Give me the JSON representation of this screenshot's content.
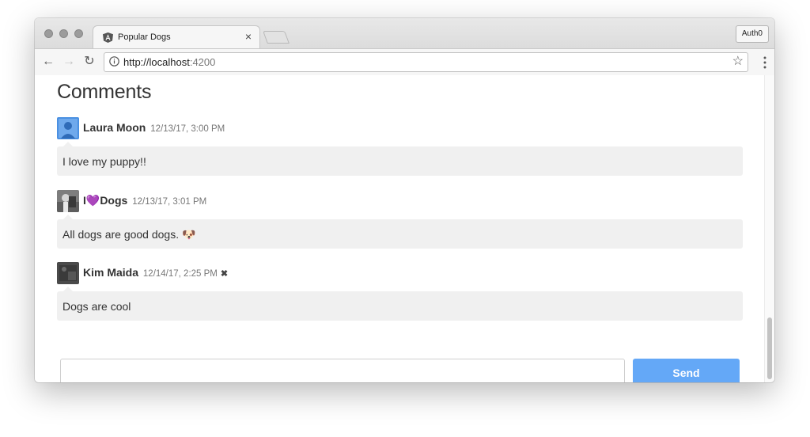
{
  "browser": {
    "tab_title": "Popular Dogs",
    "tab_close": "×",
    "profile_label": "Auth0",
    "url_host": "http://localhost",
    "url_port": ":4200",
    "favicon": "angular-icon",
    "bookmark_icon": "star-icon"
  },
  "page": {
    "title": "Comments"
  },
  "comments": [
    {
      "author": "Laura Moon",
      "timestamp": "12/13/17, 3:00 PM",
      "text": "I love my puppy!!",
      "deletable": false
    },
    {
      "author": "I💜Dogs",
      "timestamp": "12/13/17, 3:01 PM",
      "text": "All dogs are good dogs. 🐶",
      "deletable": false
    },
    {
      "author": "Kim Maida",
      "timestamp": "12/14/17, 2:25 PM",
      "text": "Dogs are cool",
      "deletable": true,
      "delete_label": "✖"
    }
  ],
  "form": {
    "input_value": "",
    "input_placeholder": "",
    "send_label": "Send"
  },
  "colors": {
    "send_button": "#64a8f7",
    "comment_bubble": "#f0f0f0"
  }
}
